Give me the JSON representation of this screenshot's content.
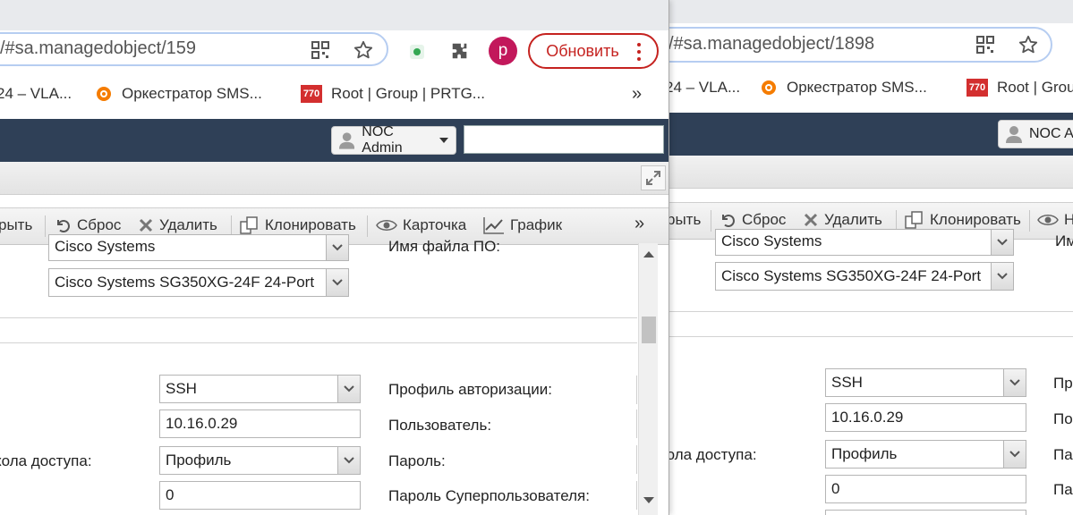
{
  "left": {
    "url": "/#sa.managedobject/159",
    "update_label": "Обновить",
    "avatar_letter": "p",
    "bookmarks": [
      "24 – VLA...",
      "Оркестратор SMS...",
      "Root | Group | PRTG..."
    ],
    "overflow": "»",
    "user_label": "NOC Admin",
    "toolbar": {
      "items": [
        "рыть",
        "Сброс",
        "Удалить",
        "Клонировать",
        "Карточка",
        "График"
      ],
      "more": "»"
    },
    "form": {
      "vendor": "Cisco Systems",
      "platform": "Cisco Systems SG350XG-24F 24-Port",
      "firmware_label": "Имя файла ПО:",
      "scheme": "SSH",
      "address": "10.16.0.29",
      "access_label": "кола доступа:",
      "access_value": "Профиль",
      "port": "0",
      "auth_profile_label": "Профиль авторизации:",
      "user_label": "Пользователь:",
      "password_label": "Пароль:",
      "super_password_label": "Пароль Суперпользователя:"
    }
  },
  "right": {
    "url": "/#sa.managedobject/1898",
    "bookmarks": [
      "24 – VLA...",
      "Оркестратор SMS...",
      "Root | Grou"
    ],
    "user_label": "NOC Ac",
    "toolbar": {
      "items": [
        "рыть",
        "Сброс",
        "Удалить",
        "Клонировать",
        "Н"
      ]
    },
    "form": {
      "vendor": "Cisco Systems",
      "platform": "Cisco Systems SG350XG-24F 24-Port",
      "firmware_label": "Им",
      "scheme": "SSH",
      "address": "10.16.0.29",
      "access_label": "кола доступа:",
      "access_value": "Профиль",
      "port": "0",
      "auth_profile_label": "Пр",
      "user_label": "По",
      "password_label": "Па",
      "super_password_label": "Па"
    }
  },
  "colors": {
    "appbar": "#2f4057",
    "update_button_border": "#c5221f",
    "avatar": "#c2185b",
    "omnibox_border": "#b6cdf1"
  }
}
